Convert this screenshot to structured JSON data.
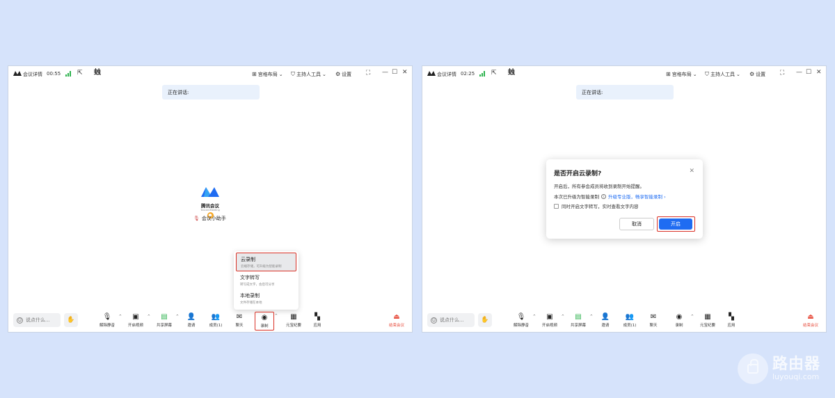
{
  "windows": {
    "left": {
      "titlebar": {
        "title": "会议详情",
        "time": "00:55",
        "layout": "宫格布局",
        "host_tools": "主持人工具",
        "settings": "设置"
      },
      "speaking": "正在讲话:",
      "brand": {
        "name": "腾讯会议",
        "sub": "TencentMeeting"
      },
      "assistant": "会议小助手",
      "chat_placeholder": "说点什么...",
      "toolbar": [
        "解除静音",
        "开启视频",
        "共享屏幕",
        "邀请",
        "成员(1)",
        "聊天",
        "录制",
        "元宝纪要",
        "应用"
      ],
      "end": "结束会议",
      "menu": [
        {
          "title": "云录制",
          "sub": "云端存储，可升级为智能录制"
        },
        {
          "title": "文字转写",
          "sub": "转写成文字，会后可分享"
        },
        {
          "title": "本地录制",
          "sub": "文件存储在本地"
        }
      ]
    },
    "right": {
      "titlebar": {
        "title": "会议详情",
        "time": "02:25",
        "layout": "宫格布局",
        "host_tools": "主持人工具",
        "settings": "设置"
      },
      "speaking": "正在讲话:",
      "chat_placeholder": "说点什么...",
      "toolbar": [
        "解除静音",
        "开启视频",
        "共享屏幕",
        "邀请",
        "成员(1)",
        "聊天",
        "录制",
        "元宝纪要",
        "应用"
      ],
      "end": "结束会议",
      "dialog": {
        "title": "是否开启云录制?",
        "line1": "开启后，所有参会成员将收到录制开始提醒。",
        "line2": "本次已升级为智能录制",
        "link": "升级专业版，畅享智能录制 ›",
        "checkbox": "同时开启文字转写，实时查看文字内容",
        "cancel": "取消",
        "confirm": "开启"
      }
    }
  },
  "watermark": {
    "cn": "路由器",
    "en": "luyouqi.com"
  },
  "colors": {
    "primary": "#1f6cf2",
    "highlight": "#d93025",
    "end": "#e74c3c",
    "signal": "#2bb24c",
    "background": "#d6e3fb"
  }
}
